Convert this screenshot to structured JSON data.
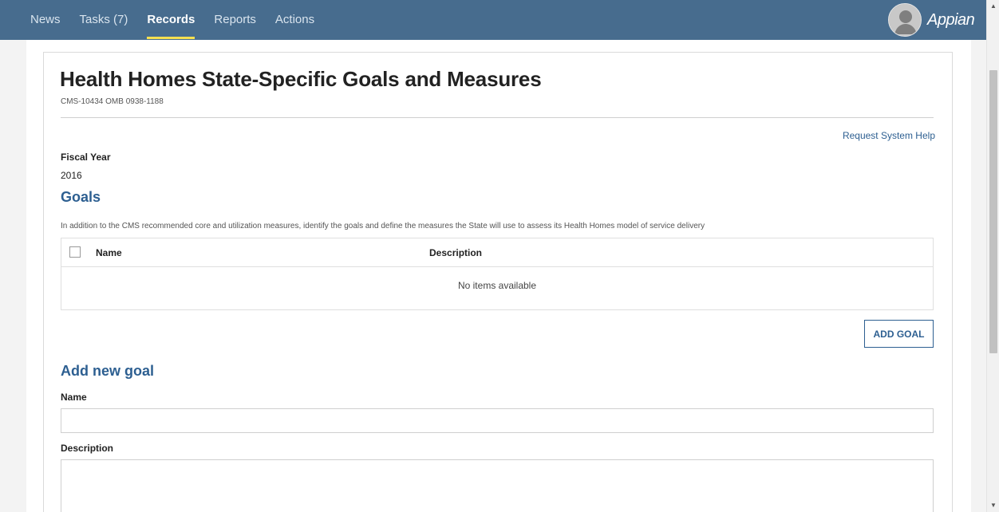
{
  "navbar": {
    "items": [
      {
        "label": "News",
        "active": false
      },
      {
        "label": "Tasks (7)",
        "active": false
      },
      {
        "label": "Records",
        "active": true
      },
      {
        "label": "Reports",
        "active": false
      },
      {
        "label": "Actions",
        "active": false
      }
    ],
    "brand": "Appian",
    "avatar_icon": "user-avatar-icon",
    "accent": "#f5e050",
    "background": "#476c8e"
  },
  "page": {
    "title": "Health Homes State-Specific Goals and Measures",
    "subtitle": "CMS-10434 OMB 0938-1188",
    "help_link": "Request System Help",
    "fiscal_year_label": "Fiscal Year",
    "fiscal_year_value": "2016",
    "goals_heading": "Goals",
    "goals_instructions": "In addition to the CMS recommended core and utilization measures, identify the goals and define the measures the State will use to assess its Health Homes model of service delivery",
    "grid": {
      "columns": [
        "Name",
        "Description"
      ],
      "empty_message": "No items available"
    },
    "add_goal_button": "ADD GOAL",
    "add_new_goal_heading": "Add new goal",
    "name_label": "Name",
    "name_value": "",
    "name_placeholder": "",
    "description_label": "Description",
    "description_value": "",
    "description_placeholder": "",
    "link_color": "#2d5f91"
  }
}
